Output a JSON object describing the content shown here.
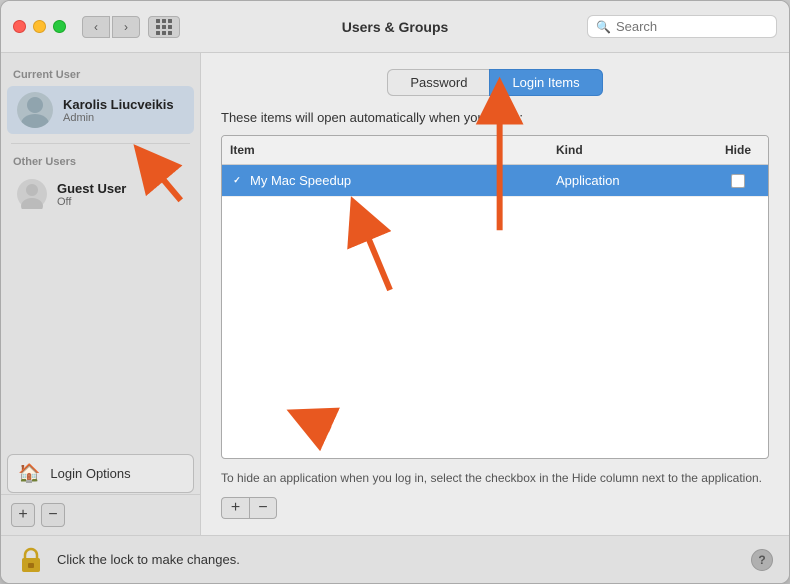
{
  "window": {
    "title": "Users & Groups"
  },
  "titlebar": {
    "back_label": "‹",
    "forward_label": "›",
    "search_placeholder": "Search"
  },
  "sidebar": {
    "current_user_label": "Current User",
    "other_users_label": "Other Users",
    "current_user": {
      "name": "Karolis Liucveikis",
      "role": "Admin"
    },
    "guest_user": {
      "name": "Guest User",
      "status": "Off"
    },
    "login_options": "Login Options",
    "add_btn": "+",
    "remove_btn": "−"
  },
  "tabs": [
    {
      "label": "Password",
      "active": false
    },
    {
      "label": "Login Items",
      "active": true
    }
  ],
  "panel": {
    "description": "These items will open automatically when you log in:",
    "table": {
      "col_item": "Item",
      "col_kind": "Kind",
      "col_hide": "Hide",
      "rows": [
        {
          "name": "My Mac Speedup",
          "kind": "Application",
          "hide": false,
          "selected": true
        }
      ]
    },
    "footer_note": "To hide an application when you log in, select the checkbox in the Hide\ncolumn next to the application.",
    "add_btn": "+",
    "remove_btn": "−"
  },
  "bottom_bar": {
    "lock_label": "Click the lock to make changes.",
    "help_label": "?"
  }
}
